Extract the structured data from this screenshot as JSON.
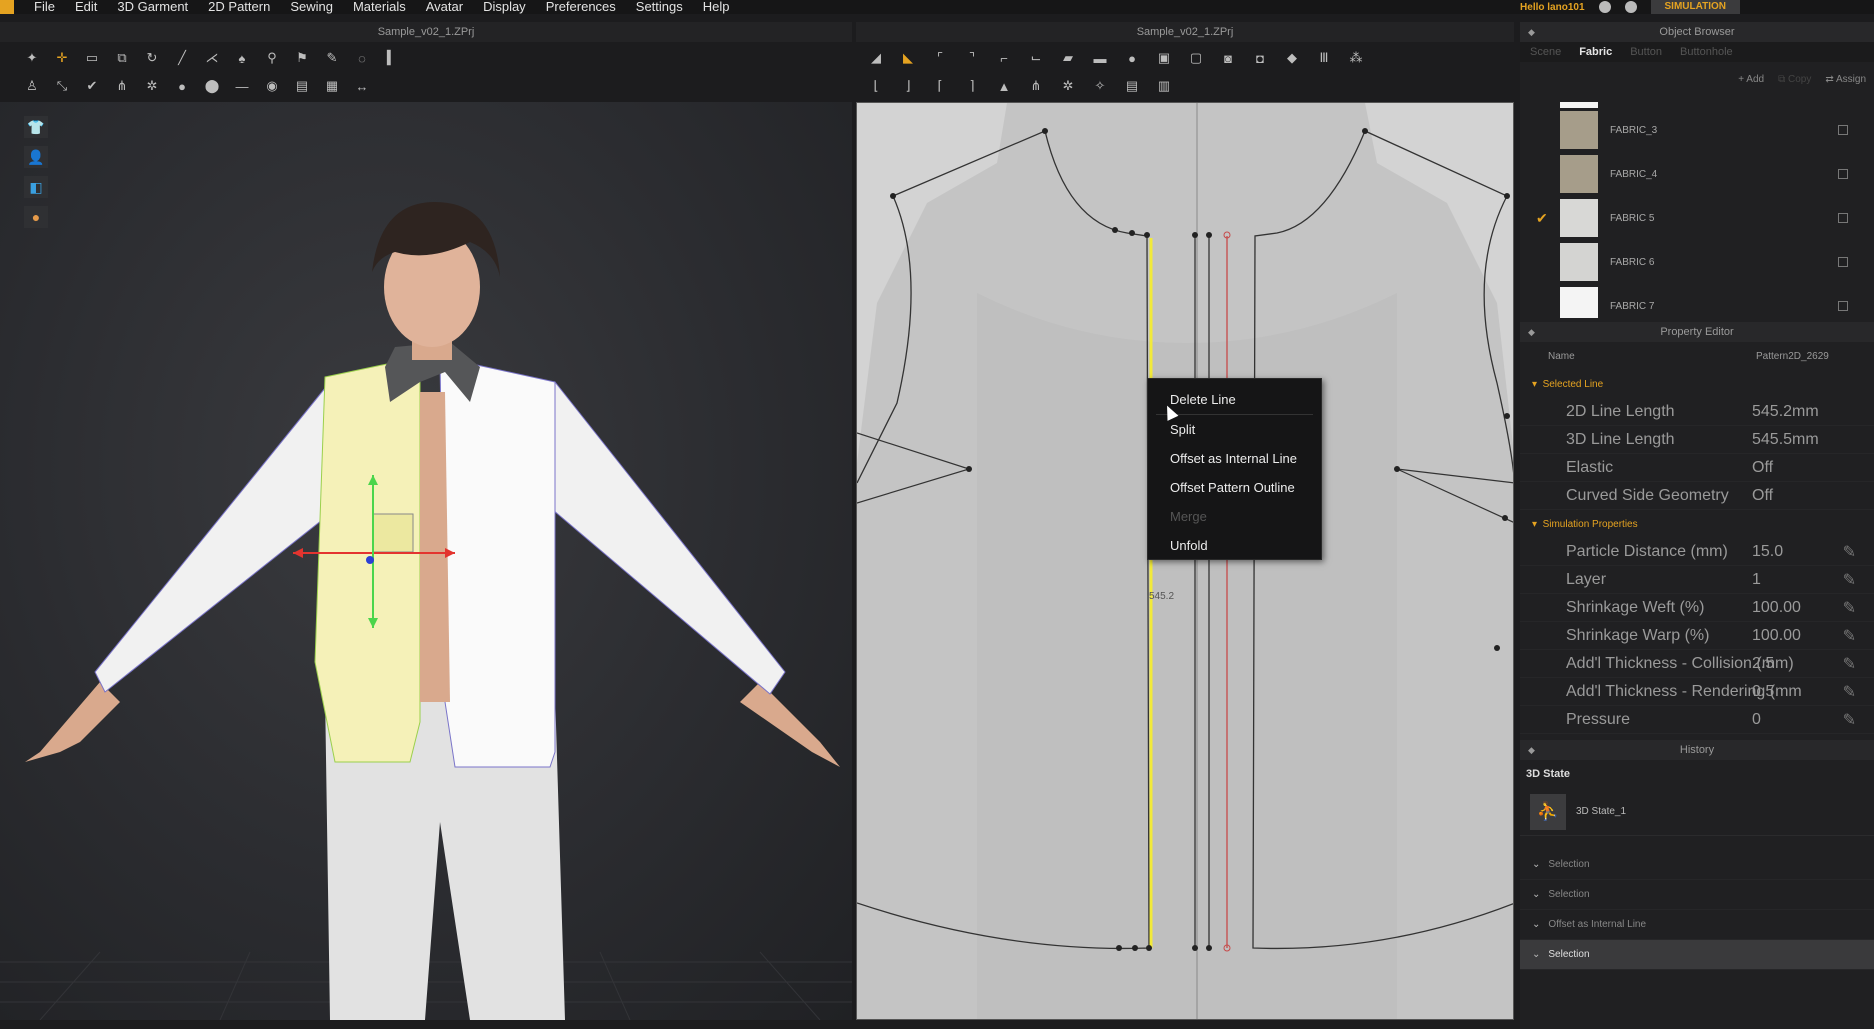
{
  "menubar": {
    "items": [
      "File",
      "Edit",
      "3D Garment",
      "2D Pattern",
      "Sewing",
      "Materials",
      "Avatar",
      "Display",
      "Preferences",
      "Settings",
      "Help"
    ],
    "user": "Hello  lano101",
    "sim_label": "SIMULATION"
  },
  "view3d": {
    "title": "Sample_v02_1.ZPrj"
  },
  "view2d": {
    "title": "Sample_v02_1.ZPrj",
    "measurement": "545.2"
  },
  "context_menu": {
    "items": [
      "Delete Line",
      "Split",
      "Offset as Internal Line",
      "Offset Pattern Outline",
      "Merge",
      "Unfold"
    ]
  },
  "object_browser": {
    "title": "Object Browser",
    "tabs": [
      "Scene",
      "Fabric",
      "Button",
      "Buttonhole"
    ],
    "add": "Add",
    "copy": "Copy",
    "assign": "Assign",
    "fabrics": [
      {
        "name": "FABRIC_3",
        "color": "#a69d8a",
        "checked": false
      },
      {
        "name": "FABRIC_4",
        "color": "#a69d8a",
        "checked": false
      },
      {
        "name": "FABRIC 5",
        "color": "#d8d8d6",
        "checked": true
      },
      {
        "name": "FABRIC 6",
        "color": "#d4d4d2",
        "checked": false
      },
      {
        "name": "FABRIC 7",
        "color": "#f4f4f4",
        "checked": false
      }
    ]
  },
  "property_editor": {
    "title": "Property Editor",
    "name_label": "Name",
    "name_value": "Pattern2D_2629",
    "section_line": "Selected Line",
    "line_props": [
      {
        "label": "2D Line Length",
        "value": "545.2mm"
      },
      {
        "label": "3D Line Length",
        "value": "545.5mm"
      },
      {
        "label": "Elastic",
        "value": "Off"
      },
      {
        "label": "Curved Side Geometry",
        "value": "Off"
      }
    ],
    "section_sim": "Simulation Properties",
    "sim_props": [
      {
        "label": "Particle Distance (mm)",
        "value": "15.0"
      },
      {
        "label": "Layer",
        "value": "1"
      },
      {
        "label": "Shrinkage Weft (%)",
        "value": "100.00"
      },
      {
        "label": "Shrinkage Warp (%)",
        "value": "100.00"
      },
      {
        "label": "Add'l Thickness - Collision (mm)",
        "value": "2.5"
      },
      {
        "label": "Add'l Thickness - Rendering (mm",
        "value": "0.5"
      },
      {
        "label": "Pressure",
        "value": "0"
      }
    ]
  },
  "history": {
    "title": "History",
    "state_header": "3D State",
    "state_item": "3D State_1",
    "rows": [
      {
        "label": "Selection",
        "selected": false
      },
      {
        "label": "Selection",
        "selected": false
      },
      {
        "label": "Offset as Internal Line",
        "selected": false
      },
      {
        "label": "Selection",
        "selected": true
      }
    ]
  },
  "colors": {
    "accent": "#e5a321",
    "selected_line": "#f2ea3a",
    "seam_red": "#c64a4a"
  }
}
